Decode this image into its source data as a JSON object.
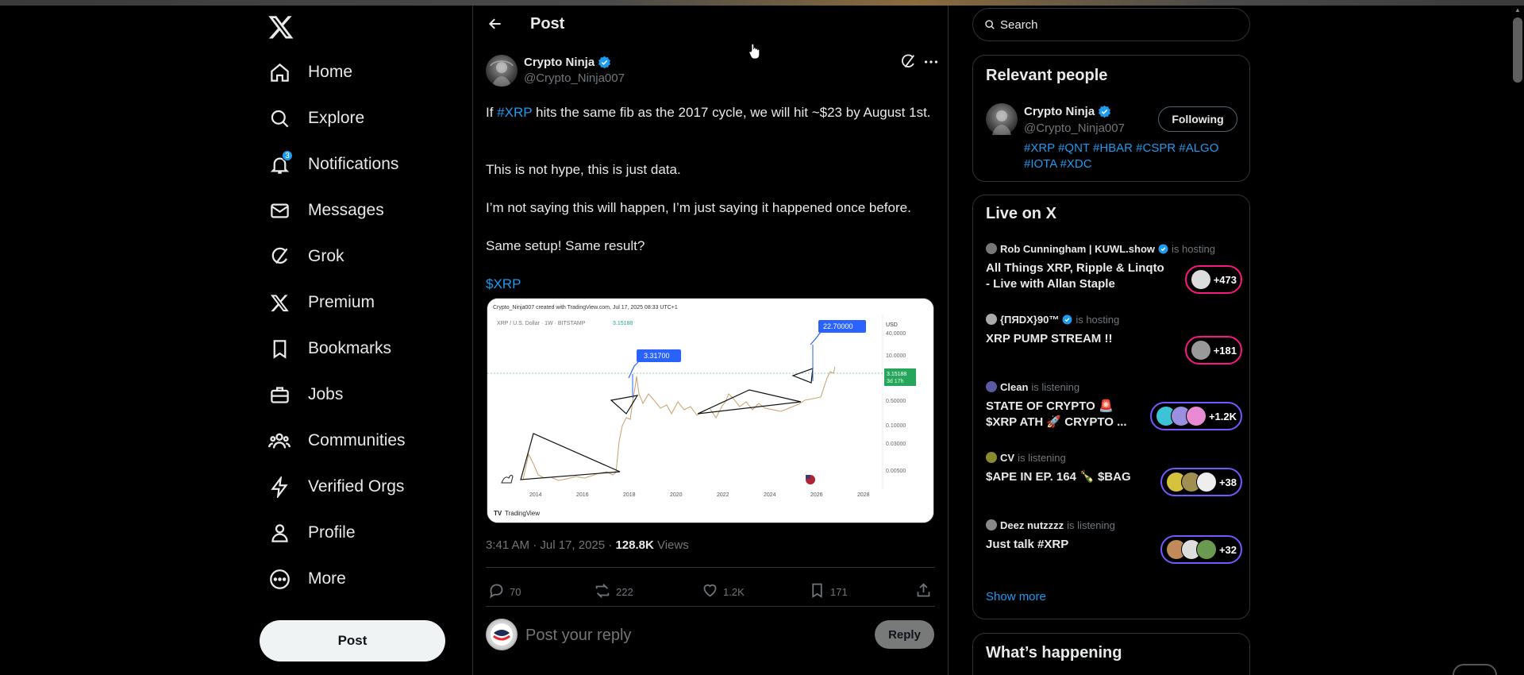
{
  "nav": {
    "items": [
      {
        "label": "Home",
        "icon": "home-icon"
      },
      {
        "label": "Explore",
        "icon": "search-icon"
      },
      {
        "label": "Notifications",
        "icon": "bell-icon",
        "badge": "3"
      },
      {
        "label": "Messages",
        "icon": "mail-icon"
      },
      {
        "label": "Grok",
        "icon": "grok-icon"
      },
      {
        "label": "Premium",
        "icon": "x-logo-icon"
      },
      {
        "label": "Bookmarks",
        "icon": "bookmark-icon"
      },
      {
        "label": "Jobs",
        "icon": "briefcase-icon"
      },
      {
        "label": "Communities",
        "icon": "people-icon"
      },
      {
        "label": "Verified Orgs",
        "icon": "lightning-icon"
      },
      {
        "label": "Profile",
        "icon": "person-icon"
      },
      {
        "label": "More",
        "icon": "more-circle-icon"
      }
    ],
    "post_button": "Post"
  },
  "header": {
    "title": "Post"
  },
  "post": {
    "author_name": "Crypto Ninja",
    "author_handle": "@Crypto_Ninja007",
    "text_lines": {
      "p1_prefix": "If ",
      "p1_tag": "#XRP",
      "p1_rest": " hits the same fib as the 2017 cycle, we will hit ~$23 by August 1st.",
      "p2": "This is not hype, this is just data.",
      "p3": "I’m not saying this will happen, I’m just saying it happened once before.",
      "p4": "Same setup! Same result?",
      "p5": "$XRP"
    },
    "timestamp": "3:41 AM · Jul 17, 2025 · ",
    "views_count": "128.8K",
    "views_label": " Views",
    "replies": "70",
    "reposts": "222",
    "likes": "1.2K",
    "bookmarks": "171"
  },
  "chart": {
    "header_text": "Crypto_Ninja007 created with TradingView.com, Jul 17, 2025 08:33 UTC+1",
    "symbol_text": "XRP / U.S. Dollar · 1W · BITSTAMP",
    "symbol_price": "3.15188",
    "currency": "USD",
    "label_high1": "3.31700",
    "label_high2": "22.70000",
    "current_price": "3.15188",
    "current_time": "3d 17h",
    "y_ticks": [
      "40.0000",
      "10.0000",
      "0.50000",
      "0.10000",
      "0.03000",
      "0.00500"
    ],
    "x_ticks": [
      "2014",
      "2016",
      "2018",
      "2020",
      "2022",
      "2024",
      "2026",
      "2028"
    ],
    "footer": "TradingView"
  },
  "reply": {
    "placeholder": "Post your reply",
    "button": "Reply"
  },
  "search": {
    "placeholder": "Search"
  },
  "relevant": {
    "title": "Relevant people",
    "name": "Crypto Ninja",
    "handle": "@Crypto_Ninja007",
    "follow_label": "Following",
    "bio_line1": "#XRP #QNT #HBAR #CSPR #ALGO",
    "bio_line2": "#IOTA #XDC"
  },
  "live": {
    "title": "Live on X",
    "items": [
      {
        "host": "Rob Cunningham | KUWL.show",
        "status": "is hosting",
        "title": "All Things XRP, Ripple & Linqto - Live with Allan Staple",
        "count": "+473"
      },
      {
        "host": "{ПЯDX}90™",
        "status": "is hosting",
        "title": "XRP PUMP STREAM !!",
        "count": "+181"
      },
      {
        "host": "Clean",
        "status": "is listening",
        "title": "STATE OF CRYPTO 🚨 $XRP ATH 🚀 CRYPTO ...",
        "count": "+1.2K"
      },
      {
        "host": "CV",
        "status": "is listening",
        "title": "$APE IN EP. 164 🍾 $BAG",
        "count": "+38"
      },
      {
        "host": "Deez nutzzzz",
        "status": "is listening",
        "title": "Just talk #XRP",
        "count": "+32"
      }
    ],
    "show_more": "Show more"
  },
  "happening": {
    "title": "What’s happening"
  },
  "colors": {
    "accent": "#1d9bf0",
    "hosting": "#f91880",
    "listening": "#7856ff"
  }
}
